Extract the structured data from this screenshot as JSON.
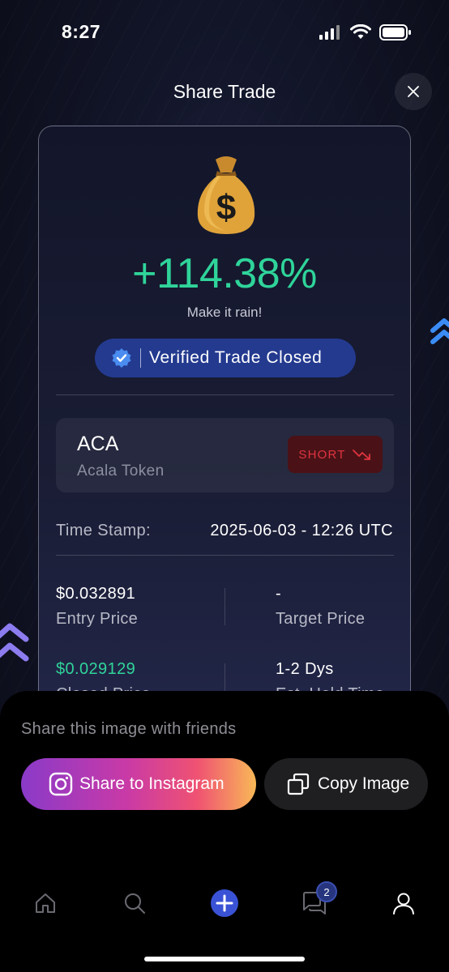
{
  "status_bar": {
    "time": "8:27"
  },
  "header": {
    "title": "Share Trade"
  },
  "card": {
    "emoji": "💰",
    "percent": "+114.38%",
    "subtitle": "Make it rain!",
    "verified_label": "Verified Trade Closed",
    "token": {
      "symbol": "ACA",
      "name": "Acala Token",
      "direction": "SHORT"
    },
    "timestamp": {
      "label": "Time Stamp:",
      "value": "2025-06-03 - 12:26 UTC"
    },
    "stats": [
      {
        "value": "$0.032891",
        "label": "Entry Price"
      },
      {
        "value": "-",
        "label": "Target Price"
      },
      {
        "value": "$0.029129",
        "label": "Closed Price"
      },
      {
        "value": "1-2 Dys",
        "label": "Est. Hold Time"
      }
    ]
  },
  "sheet": {
    "title": "Share this image with friends",
    "instagram_label": "Share to Instagram",
    "copy_label": "Copy Image"
  },
  "tabbar": {
    "items": [
      "home",
      "search",
      "create",
      "messages",
      "profile"
    ],
    "messages_badge": "2"
  },
  "colors": {
    "positive": "#2fd49a",
    "verified_bg": "#233a8f",
    "short_red": "#e0343f",
    "accent_blue": "#3a52d6"
  }
}
